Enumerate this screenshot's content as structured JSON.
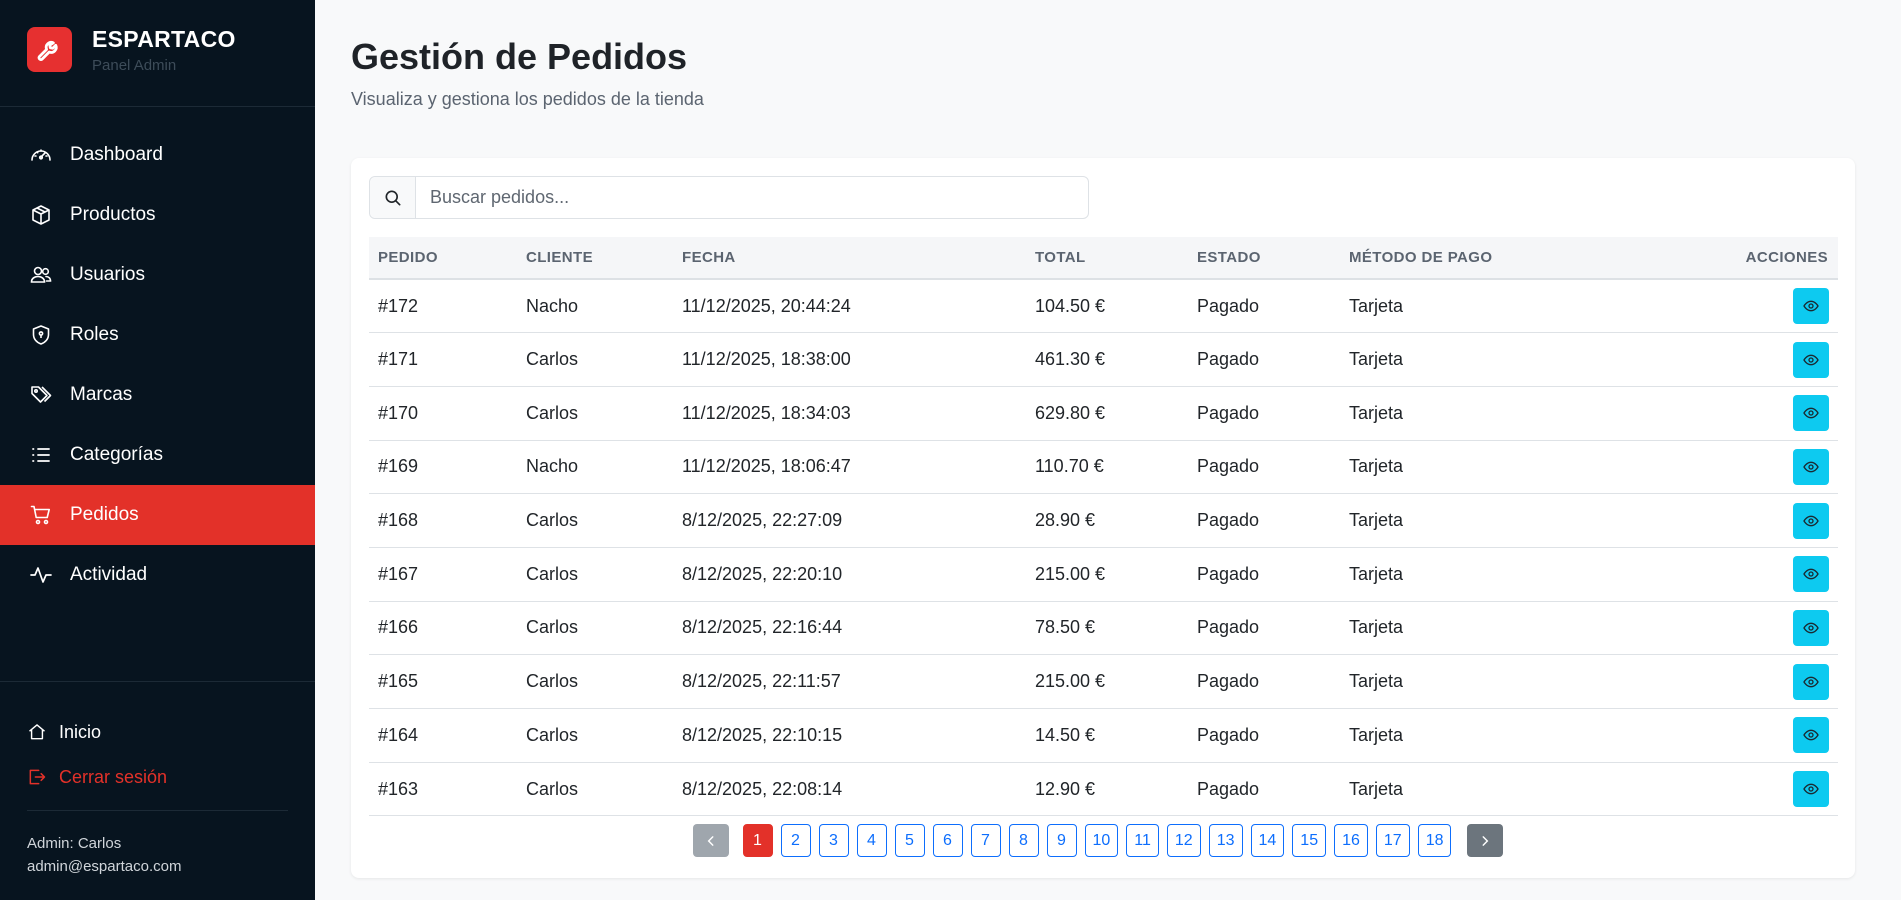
{
  "brand": {
    "title": "ESPARTACO",
    "subtitle": "Panel Admin"
  },
  "nav": [
    {
      "label": "Dashboard",
      "icon": "speedometer-icon",
      "active": false
    },
    {
      "label": "Productos",
      "icon": "box-icon",
      "active": false
    },
    {
      "label": "Usuarios",
      "icon": "users-icon",
      "active": false
    },
    {
      "label": "Roles",
      "icon": "shield-icon",
      "active": false
    },
    {
      "label": "Marcas",
      "icon": "tags-icon",
      "active": false
    },
    {
      "label": "Categorías",
      "icon": "list-icon",
      "active": false
    },
    {
      "label": "Pedidos",
      "icon": "cart-icon",
      "active": true
    },
    {
      "label": "Actividad",
      "icon": "activity-icon",
      "active": false
    }
  ],
  "footer": {
    "home_label": "Inicio",
    "logout_label": "Cerrar sesión",
    "admin_name": "Admin: Carlos",
    "admin_email": "admin@espartaco.com"
  },
  "page": {
    "title": "Gestión de Pedidos",
    "subtitle": "Visualiza y gestiona los pedidos de la tienda"
  },
  "search": {
    "placeholder": "Buscar pedidos...",
    "value": ""
  },
  "table": {
    "headers": [
      "PEDIDO",
      "CLIENTE",
      "FECHA",
      "TOTAL",
      "ESTADO",
      "MÉTODO DE PAGO",
      "ACCIONES"
    ],
    "rows": [
      [
        "#172",
        "Nacho",
        "11/12/2025, 20:44:24",
        "104.50 €",
        "Pagado",
        "Tarjeta"
      ],
      [
        "#171",
        "Carlos",
        "11/12/2025, 18:38:00",
        "461.30 €",
        "Pagado",
        "Tarjeta"
      ],
      [
        "#170",
        "Carlos",
        "11/12/2025, 18:34:03",
        "629.80 €",
        "Pagado",
        "Tarjeta"
      ],
      [
        "#169",
        "Nacho",
        "11/12/2025, 18:06:47",
        "110.70 €",
        "Pagado",
        "Tarjeta"
      ],
      [
        "#168",
        "Carlos",
        "8/12/2025, 22:27:09",
        "28.90 €",
        "Pagado",
        "Tarjeta"
      ],
      [
        "#167",
        "Carlos",
        "8/12/2025, 22:20:10",
        "215.00 €",
        "Pagado",
        "Tarjeta"
      ],
      [
        "#166",
        "Carlos",
        "8/12/2025, 22:16:44",
        "78.50 €",
        "Pagado",
        "Tarjeta"
      ],
      [
        "#165",
        "Carlos",
        "8/12/2025, 22:11:57",
        "215.00 €",
        "Pagado",
        "Tarjeta"
      ],
      [
        "#164",
        "Carlos",
        "8/12/2025, 22:10:15",
        "14.50 €",
        "Pagado",
        "Tarjeta"
      ],
      [
        "#163",
        "Carlos",
        "8/12/2025, 22:08:14",
        "12.90 €",
        "Pagado",
        "Tarjeta"
      ]
    ]
  },
  "pagination": {
    "pages": [
      "1",
      "2",
      "3",
      "4",
      "5",
      "6",
      "7",
      "8",
      "9",
      "10",
      "11",
      "12",
      "13",
      "14",
      "15",
      "16",
      "17",
      "18"
    ],
    "current": "1"
  },
  "colors": {
    "sidebar_bg": "#07141f",
    "accent": "#e33129",
    "view_button": "#0dcaf0",
    "link": "#0d6efd"
  }
}
